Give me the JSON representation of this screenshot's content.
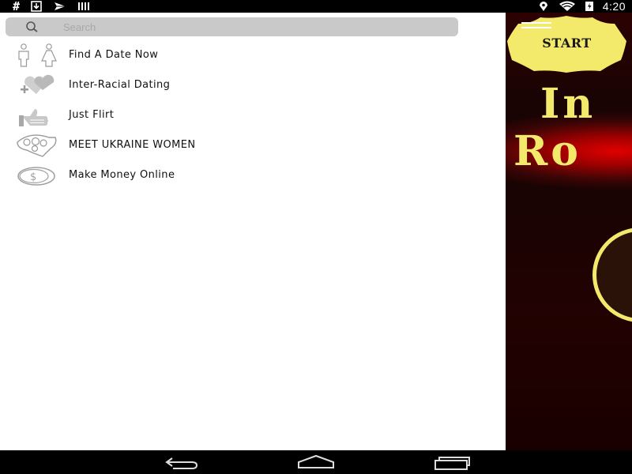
{
  "status_bar": {
    "left_hash": "#",
    "time": "4:20",
    "icons": [
      "hash-icon",
      "download-icon",
      "send-icon",
      "barcode-icon",
      "location-icon",
      "wifi-icon",
      "battery-icon"
    ]
  },
  "search": {
    "placeholder": "Search",
    "value": ""
  },
  "menu": {
    "items": [
      {
        "label": "Find A Date Now",
        "icon": "man-woman-icon"
      },
      {
        "label": "Inter-Racial Dating",
        "icon": "hearts-icon"
      },
      {
        "label": "Just Flirt",
        "icon": "thumbs-up-icon"
      },
      {
        "label": "MEET UKRAINE WOMEN",
        "icon": "bouquet-icon"
      },
      {
        "label": "Make Money Online",
        "icon": "dollar-coin-icon"
      }
    ]
  },
  "background_app": {
    "start_label": "START",
    "title_line1": "In",
    "title_line2": "Ro",
    "accent_color": "#f3e96b",
    "bg_color": "#c00000"
  },
  "nav_bar": {
    "icons": [
      "back-icon",
      "home-icon",
      "recent-apps-icon"
    ]
  }
}
